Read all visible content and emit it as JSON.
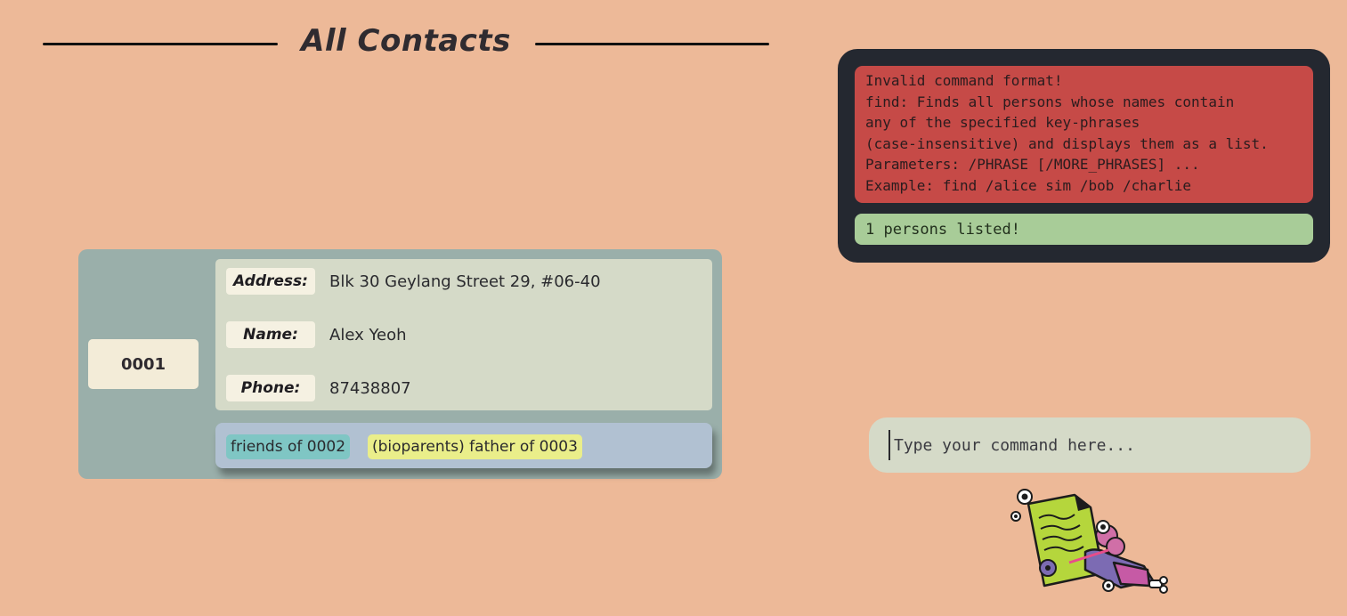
{
  "header": {
    "title": "All Contacts"
  },
  "contact": {
    "id": "0001",
    "fields": [
      {
        "label": "Address:",
        "value": "Blk 30 Geylang Street 29, #06-40"
      },
      {
        "label": "Name:",
        "value": "Alex Yeoh"
      },
      {
        "label": "Phone:",
        "value": "87438807"
      }
    ],
    "tags": [
      {
        "text": "friends of 0002",
        "color": "#7fc6c4"
      },
      {
        "text": "(bioparents) father of 0003",
        "color": "#eaee8a"
      }
    ]
  },
  "result": {
    "error_lines": [
      "Invalid command format!",
      "find: Finds all persons whose names contain",
      "any of the specified key-phrases",
      "(case-insensitive) and displays them as a list.",
      "Parameters: /PHRASE [/MORE_PHRASES] ...",
      "Example: find /alice sim /bob /charlie"
    ],
    "success": "1 persons listed!"
  },
  "command": {
    "placeholder": "Type your command here..."
  },
  "illustration": {
    "icon": "document-signing-icon"
  },
  "colors": {
    "background": "#edb998",
    "card": "#9aafaa",
    "details": "#d5dac8",
    "result_panel": "#242830",
    "error": "#c64a47",
    "success": "#a8cc98"
  }
}
